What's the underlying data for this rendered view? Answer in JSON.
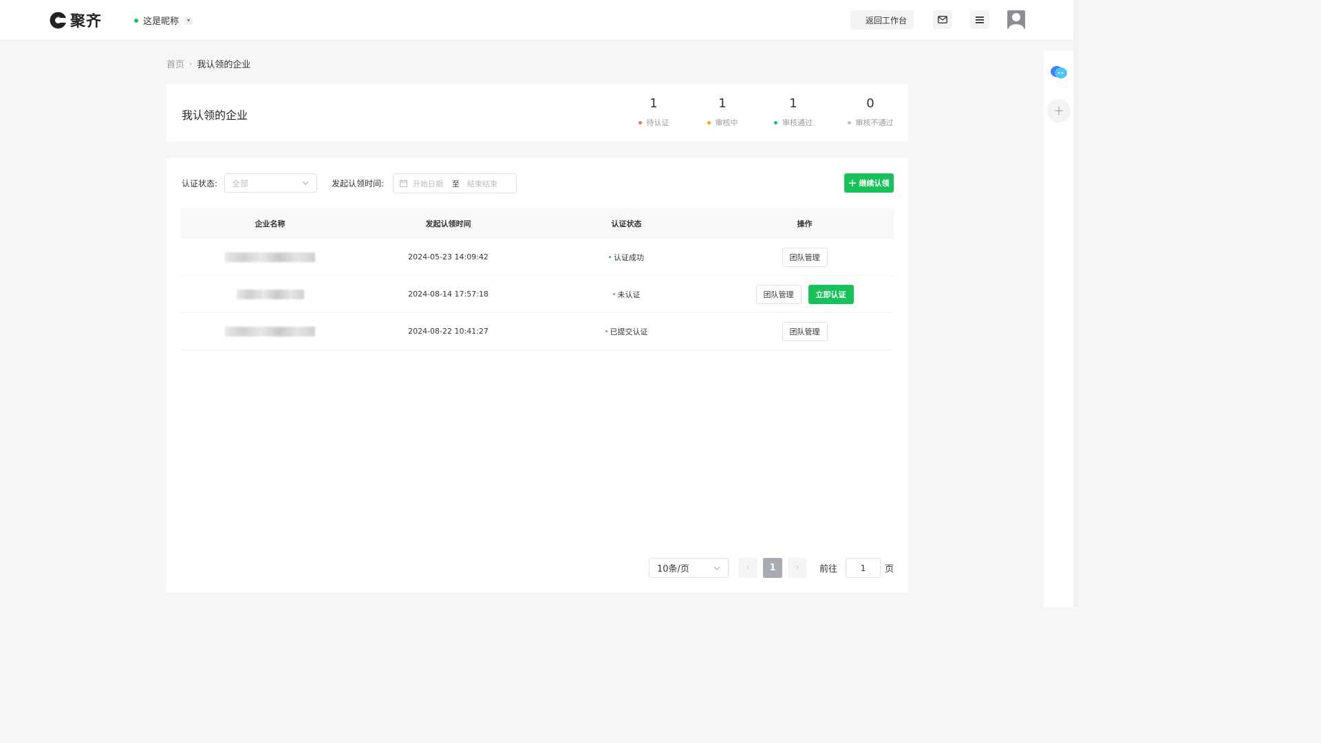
{
  "header": {
    "logo_text": "聚齐",
    "nickname": "这是昵称",
    "workbench_label": "返回工作台"
  },
  "breadcrumb": {
    "home": "首页",
    "current": "我认领的企业"
  },
  "summary": {
    "title": "我认领的企业",
    "stats": [
      {
        "count": "1",
        "label": "待认证",
        "color": "#f56c6c"
      },
      {
        "count": "1",
        "label": "审核中",
        "color": "#f5a623"
      },
      {
        "count": "1",
        "label": "审核通过",
        "color": "#19be6b"
      },
      {
        "count": "0",
        "label": "审核不通过",
        "color": "#c0c4cc"
      }
    ]
  },
  "filters": {
    "status_label": "认证状态:",
    "status_value": "全部",
    "time_label": "发起认领时间:",
    "start_placeholder": "开始日期",
    "range_sep": "至",
    "end_placeholder": "结束结束",
    "continue_label": "继续认领"
  },
  "table": {
    "columns": [
      "企业名称",
      "发起认领时间",
      "认证状态",
      "操作"
    ],
    "rows": [
      {
        "name": "",
        "time": "2024-05-23 14:09:42",
        "status": "认证成功",
        "status_color": "#19be6b",
        "team": "团队管理",
        "certify": ""
      },
      {
        "name": "",
        "time": "2024-08-14 17:57:18",
        "status": "未认证",
        "status_color": "#909399",
        "team": "团队管理",
        "certify": "立即认证"
      },
      {
        "name": "",
        "time": "2024-08-22 10:41:27",
        "status": "已提交认证",
        "status_color": "#909399",
        "team": "团队管理",
        "certify": ""
      }
    ]
  },
  "pagination": {
    "page_size": "10条/页",
    "current_page": "1",
    "goto_label": "前往",
    "goto_value": "1",
    "page_suffix": "页"
  },
  "colors": {
    "accent": "#19c15a",
    "page_bg": "#f5f6f8"
  }
}
